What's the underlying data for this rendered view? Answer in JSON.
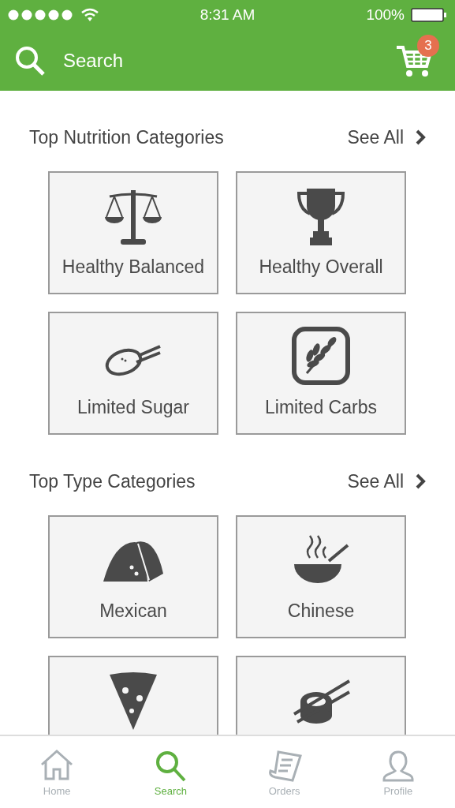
{
  "status_bar": {
    "time": "8:31 AM",
    "battery": "100%"
  },
  "header": {
    "search_label": "Search",
    "cart_count": "3"
  },
  "sections": [
    {
      "title": "Top Nutrition Categories",
      "see_all": "See All",
      "tiles": [
        {
          "kind": "scale",
          "label": "Healthy Balanced"
        },
        {
          "kind": "trophy",
          "label": "Healthy Overall"
        },
        {
          "kind": "spoon",
          "label": "Limited Sugar"
        },
        {
          "kind": "wheat",
          "label": "Limited Carbs"
        }
      ]
    },
    {
      "title": "Top Type Categories",
      "see_all": "See All",
      "tiles": [
        {
          "kind": "taco",
          "label": "Mexican"
        },
        {
          "kind": "bowl",
          "label": "Chinese"
        },
        {
          "kind": "pizza"
        },
        {
          "kind": "sushi"
        }
      ]
    }
  ],
  "tab_bar": [
    {
      "kind": "home",
      "label": "Home",
      "selected": false
    },
    {
      "kind": "search",
      "label": "Search",
      "selected": true
    },
    {
      "kind": "orders",
      "label": "Orders",
      "selected": false
    },
    {
      "kind": "profile",
      "label": "Profile",
      "selected": false
    }
  ]
}
